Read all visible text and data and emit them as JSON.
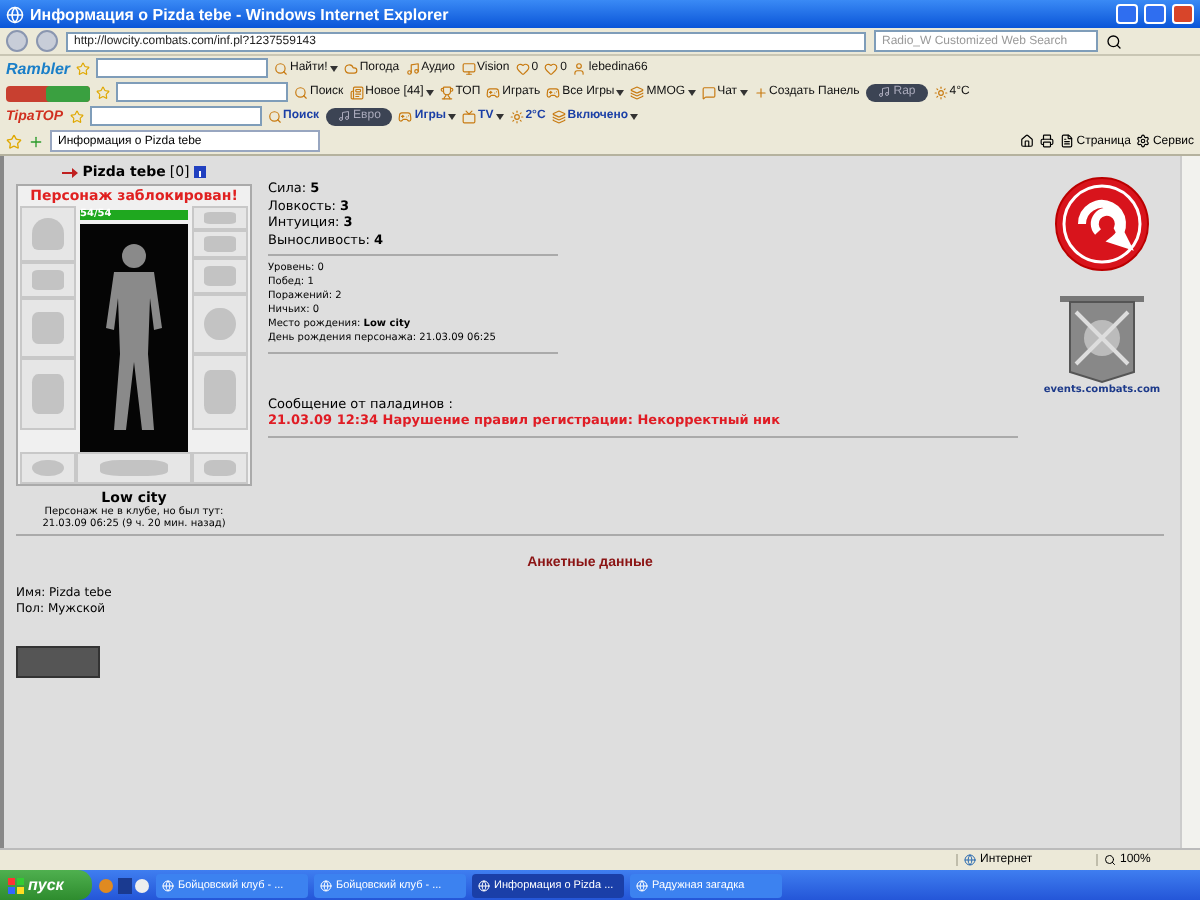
{
  "window": {
    "title": "Информация о Pizda tebe - Windows Internet Explorer"
  },
  "address_bar": {
    "url": "http://lowcity.combats.com/inf.pl?1237559143"
  },
  "search": {
    "placeholder": "Radio_W Customized Web Search"
  },
  "toolbars": [
    {
      "logo": "Rambler",
      "items": [
        {
          "label": "Найти!",
          "kind": "dropdown"
        },
        {
          "label": "Погода",
          "kind": "button"
        },
        {
          "label": "Аудио",
          "kind": "button"
        },
        {
          "label": "Vision",
          "kind": "button"
        },
        {
          "label": "0",
          "kind": "button"
        },
        {
          "label": "0",
          "kind": "button"
        },
        {
          "label": "lebedina66",
          "kind": "button"
        }
      ]
    },
    {
      "items": [
        {
          "label": "Поиск",
          "kind": "button"
        },
        {
          "label": "Новое  [44]",
          "kind": "dropdown"
        },
        {
          "label": "ТОП",
          "kind": "button"
        },
        {
          "label": "Играть",
          "kind": "button"
        },
        {
          "label": "Все Игры",
          "kind": "dropdown"
        },
        {
          "label": "MMOG",
          "kind": "dropdown"
        },
        {
          "label": "Чат",
          "kind": "dropdown"
        },
        {
          "label": "Создать Панель",
          "kind": "button"
        },
        {
          "label": "Rap",
          "kind": "player"
        },
        {
          "label": "4°C",
          "kind": "button"
        }
      ]
    },
    {
      "logo": "TipaTOP",
      "items": [
        {
          "label": "Поиск",
          "kind": "button",
          "bold": true
        },
        {
          "label": "Евро",
          "kind": "player"
        },
        {
          "label": "Игры",
          "kind": "dropdown",
          "bold": true
        },
        {
          "label": "TV",
          "kind": "dropdown",
          "bold": true
        },
        {
          "label": "2°C",
          "kind": "button",
          "bold": true
        },
        {
          "label": "Включено",
          "kind": "dropdown",
          "bold": true
        }
      ]
    }
  ],
  "tab": {
    "title": "Информация о Pizda tebe"
  },
  "command_bar": {
    "items": [
      {
        "label": "Страница"
      },
      {
        "label": "Сервис"
      }
    ]
  },
  "character": {
    "name": "Pizda tebe",
    "level": "[0]",
    "status": "Персонаж заблокирован!",
    "hp": {
      "reading": "54/54",
      "level": 1
    },
    "city": "Low city",
    "presence": "Персонаж не в клубе, но был тут:",
    "last_seen": "21.03.09 06:25 (9 ч. 20 мин. назад)"
  },
  "stats": [
    "Сила: **5**",
    "Ловкость: **3**",
    "Интуиция: **3**",
    "Выносливость: **4**"
  ],
  "info": [
    "Уровень: 0",
    "Побед: 1",
    "Поражений: 2",
    "Ничьих: 0",
    "Место рождения: **Low city**",
    "День рождения персонажа: 21.03.09 06:25"
  ],
  "message": {
    "title": "Сообщение от паладинов :",
    "text": "21.03.09 12:34 Нарушение правил регистрации: Некорректный ник"
  },
  "events_link": "events.combats.com",
  "profile": {
    "title": "Анкетные данные",
    "lines": [
      "Имя: Pizda tebe",
      "Пол: Мужской"
    ]
  },
  "status_bar": {
    "zone": "Интернет",
    "zoom": "100%"
  },
  "taskbar": {
    "start": "пуск",
    "tasks": [
      {
        "label": "Бойцовский клуб - ...",
        "selected": false
      },
      {
        "label": "Бойцовский клуб - ...",
        "selected": false
      },
      {
        "label": "Информация о Pizda ...",
        "selected": true
      },
      {
        "label": "Радужная загадка",
        "selected": false
      }
    ]
  }
}
